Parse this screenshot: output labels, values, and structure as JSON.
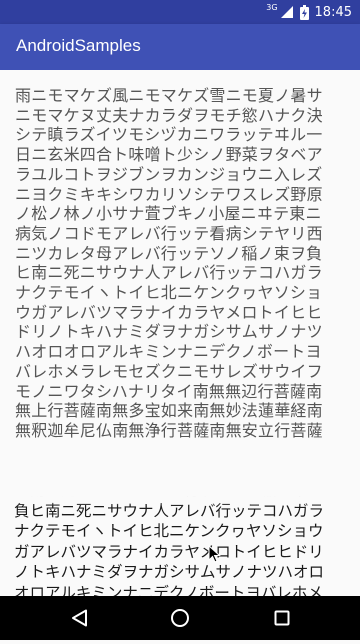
{
  "status_bar": {
    "network_label": "3G",
    "time": "18:45",
    "color": "#303f9f"
  },
  "app_bar": {
    "title": "AndroidSamples",
    "color": "#3f51b5"
  },
  "content": {
    "poem_text": "雨ニモマケズ風ニモマケズ雪ニモ夏ノ暑サニモマケヌ丈夫ナカラダヲモチ慾ハナク決シテ瞋ラズイツモシヅカニワラッテヰル一日ニ玄米四合ト味噌ト少シノ野菜ヲタベアラユルコトヲジブンヲカンジョウニ入レズニヨクミキキシワカリソシテワスレズ野原ノ松ノ林ノ小サナ萓ブキノ小屋ニヰテ東ニ病気ノコドモアレバ行ッテ看病シテヤリ西ニツカレタ母アレバ行ッテソノ稲ノ束ヲ負ヒ南ニ死ニサウナ人アレバ行ッテコハガラナクテモイヽトイヒ北ニケンクヮヤソショウガアレバツマラナイカラヤメロトイヒヒドリノトキハナミダヲナガシサムサノナツハオロオロアルキミンナニデクノボートヨバレホメラレモセズクニモサレズサウイフモノニワタシハナリタイ南無無辺行菩薩南無上行菩薩南無多宝如来南無妙法蓮華経南無釈迦牟尼仏南無浄行菩薩南無安立行菩薩",
    "ticker_text": "ニ南ニ死ニサウナ人アバ行ッテソノ稲ノ束ヲ負ヒ南ニ死ニサウナ人アレバ行ッテコハガラナクテモイヽトイヒ北ニケンクヮヤソショウガアレバツマラナイカラヤメロトイヒヒドリノトキハナミダヲナガシサムサノナツハオロオロアルキミンナニデクノボートヨバレホメラレモセズ"
  },
  "navigation": {
    "back": "back-icon",
    "home": "home-icon",
    "recents": "recents-icon"
  }
}
